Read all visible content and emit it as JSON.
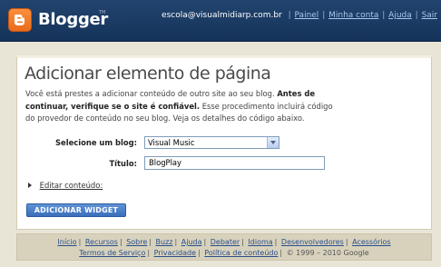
{
  "header": {
    "brand": "Blogger",
    "tm": "TM",
    "email": "escola@visualmidiarp.com.br",
    "links": [
      "Painel",
      "Minha conta",
      "Ajuda",
      "Sair"
    ]
  },
  "main": {
    "title": "Adicionar elemento de página",
    "desc_prefix": "Você está prestes a adicionar conteúdo de outro site ao seu blog.",
    "desc_bold": "Antes de continuar, verifique se o site é confiável.",
    "desc_suffix": "Esse procedimento incluirá código do provedor de conteúdo no seu blog. Veja os detalhes do código abaixo.",
    "blog_label": "Selecione um blog:",
    "blog_value": "Visual Music",
    "title_label": "Título:",
    "title_value": "BlogPlay",
    "edit_link": "Editar conteúdo:",
    "add_button": "ADICIONAR WIDGET"
  },
  "footer": {
    "row1": [
      "Início",
      "Recursos",
      "Sobre",
      "Buzz",
      "Ajuda",
      "Debater",
      "Idioma",
      "Desenvolvedores",
      "Acessórios"
    ],
    "row2": [
      "Termos de Serviço",
      "Privacidade",
      "Política de conteúdo"
    ],
    "copyright": "© 1999 – 2010 Google"
  }
}
